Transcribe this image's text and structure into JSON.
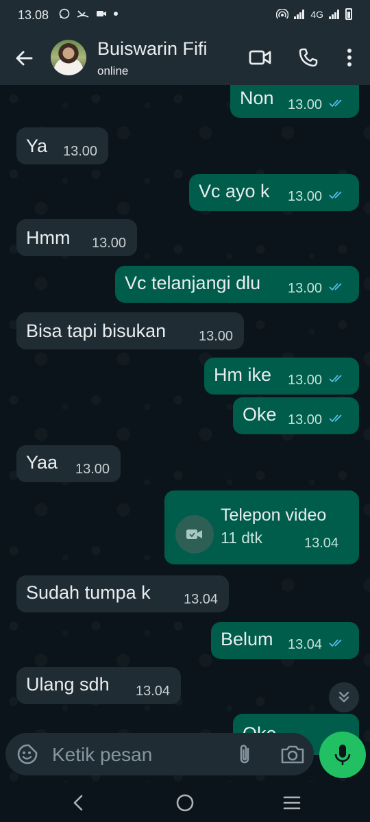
{
  "status_bar": {
    "time": "13.08",
    "network": "4G"
  },
  "header": {
    "contact_name": "Buiswarin Fifi",
    "contact_status": "online",
    "icons": [
      "back-arrow-icon",
      "video-call-icon",
      "phone-icon",
      "more-vert-icon"
    ]
  },
  "messages": [
    {
      "dir": "out",
      "text": "Non",
      "time": "13.00",
      "read": true
    },
    {
      "dir": "in",
      "text": "Ya",
      "time": "13.00"
    },
    {
      "dir": "out",
      "text": "Vc ayo k",
      "time": "13.00",
      "read": true
    },
    {
      "dir": "in",
      "text": "Hmm",
      "time": "13.00"
    },
    {
      "dir": "out",
      "text": "Vc telanjangi dlu",
      "time": "13.00",
      "read": true
    },
    {
      "dir": "in",
      "text": "Bisa tapi bisukan",
      "time": "13.00"
    },
    {
      "dir": "out",
      "text": "Hm ike",
      "time": "13.00",
      "read": true
    },
    {
      "dir": "out",
      "text": "Oke",
      "time": "13.00",
      "read": true
    },
    {
      "dir": "in",
      "text": "Yaa",
      "time": "13.00"
    },
    {
      "dir": "out",
      "type": "call",
      "title": "Telepon video",
      "duration": "11 dtk",
      "time": "13.04"
    },
    {
      "dir": "in",
      "text": "Sudah tumpa k",
      "time": "13.04"
    },
    {
      "dir": "out",
      "text": "Belum",
      "time": "13.04",
      "read": true
    },
    {
      "dir": "in",
      "text": "Ulang sdh",
      "time": "13.04"
    },
    {
      "dir": "out",
      "text": "Oke",
      "time": "",
      "partial": true
    }
  ],
  "composer": {
    "placeholder": "Ketik pesan"
  },
  "colors": {
    "header_bg": "#1f2c34",
    "chat_bg": "#0b141a",
    "incoming_bubble": "#202c33",
    "outgoing_bubble": "#005c4b",
    "read_tick": "#53bdeb",
    "mic_button": "#21c063"
  }
}
